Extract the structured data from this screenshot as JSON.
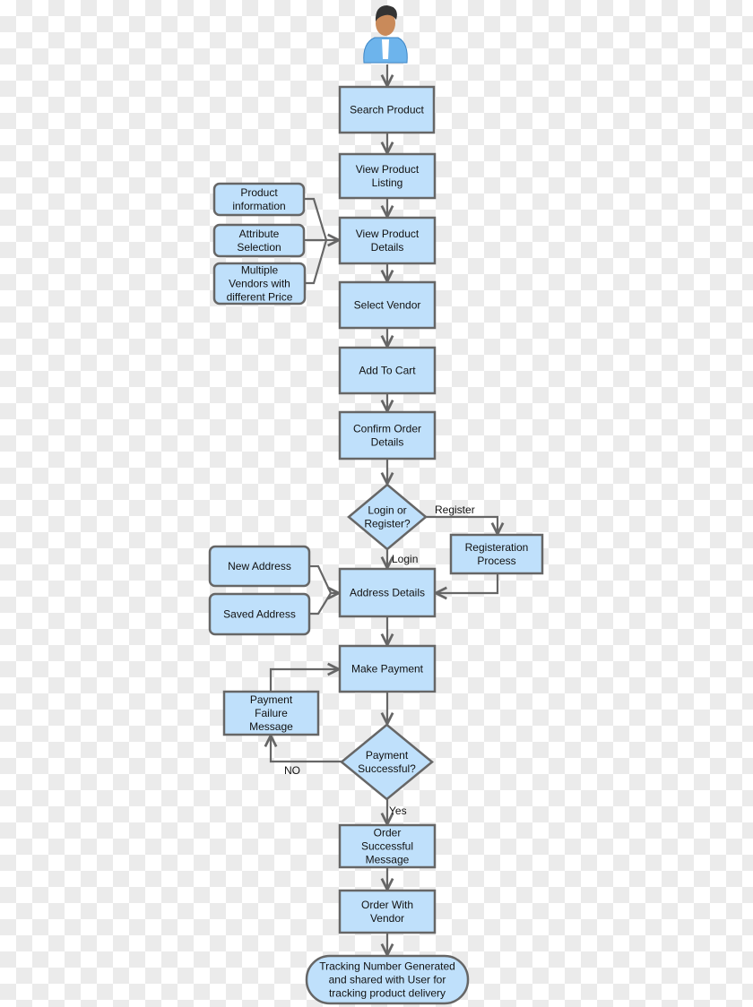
{
  "colors": {
    "node_fill": "#bfe0fb",
    "stroke": "#666666"
  },
  "icons": {
    "start": "user-avatar-icon"
  },
  "nodes": {
    "search_product": [
      "Search Product"
    ],
    "view_listing": [
      "View Product",
      "Listing"
    ],
    "view_details": [
      "View Product",
      "Details"
    ],
    "select_vendor": [
      "Select Vendor"
    ],
    "add_to_cart": [
      "Add To Cart"
    ],
    "confirm_order": [
      "Confirm Order",
      "Details"
    ],
    "login_register": [
      "Login or",
      "Register?"
    ],
    "registration": [
      "Registeration",
      "Process"
    ],
    "address_details": [
      "Address Details"
    ],
    "make_payment": [
      "Make Payment"
    ],
    "payment_failure": [
      "Payment",
      "Failure",
      "Message"
    ],
    "payment_successful": [
      "Payment",
      "Successful?"
    ],
    "order_success": [
      "Order",
      "Successful",
      "Message"
    ],
    "order_vendor": [
      "Order With",
      "Vendor"
    ],
    "tracking": [
      "Tracking Number Generated",
      "and shared with User for",
      "tracking product delivery"
    ],
    "product_info": [
      "Product",
      "information"
    ],
    "attribute_selection": [
      "Attribute",
      "Selection"
    ],
    "multiple_vendors": [
      "Multiple",
      "Vendors with",
      "different Price"
    ],
    "new_address": [
      "New Address"
    ],
    "saved_address": [
      "Saved Address"
    ]
  },
  "edge_labels": {
    "register": "Register",
    "login": "Login",
    "no": "NO",
    "yes": "Yes"
  }
}
